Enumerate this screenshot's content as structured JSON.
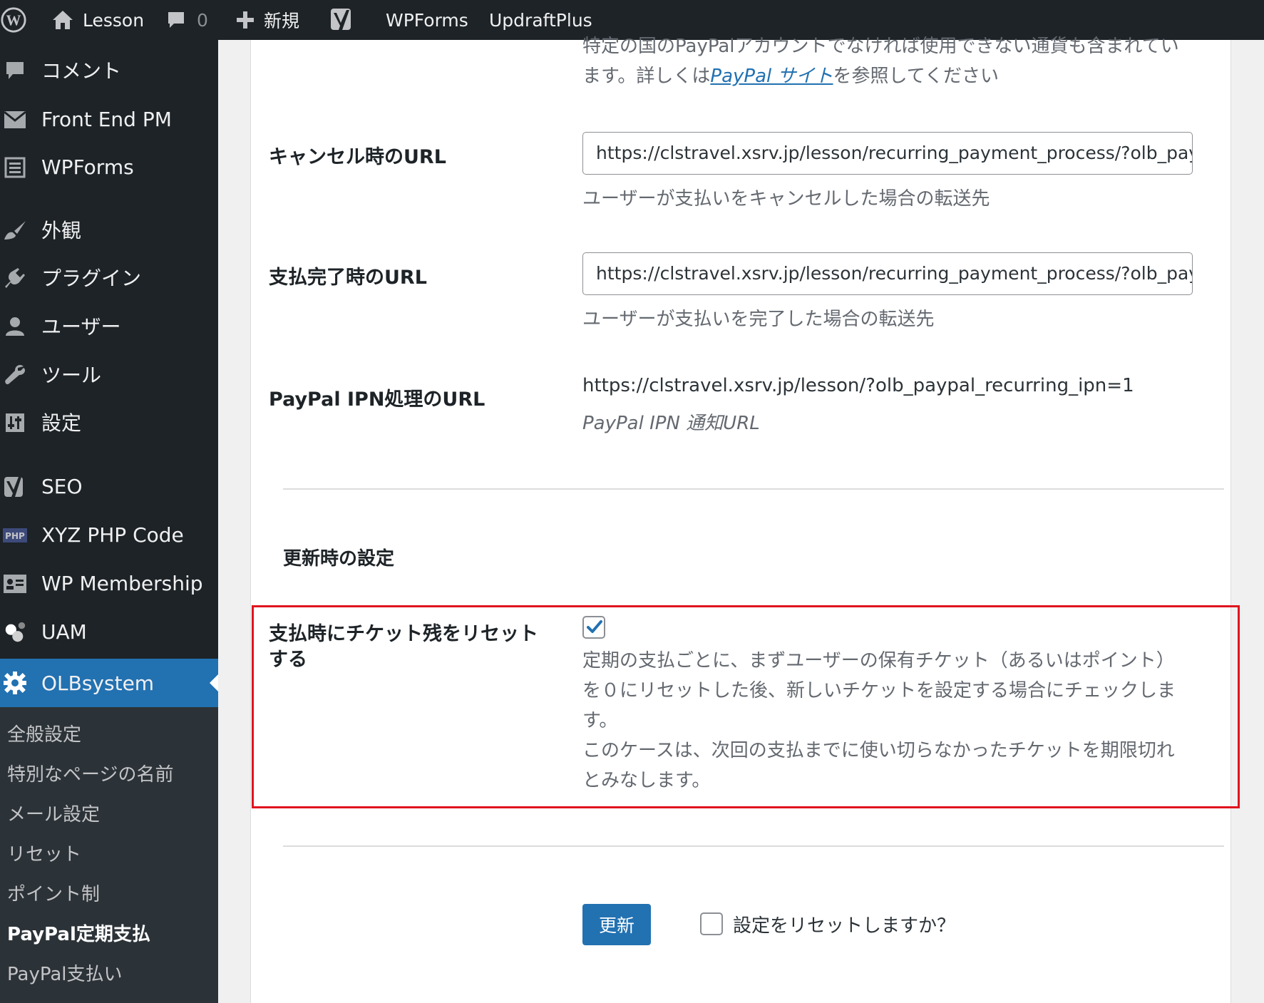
{
  "adminbar": {
    "site_name": "Lesson",
    "comments_count": "0",
    "new_label": "新規",
    "wpforms": "WPForms",
    "updraft": "UpdraftPlus"
  },
  "sidebar": {
    "items": [
      {
        "label": "コメント",
        "icon": "comment-icon"
      },
      {
        "label": "Front End PM",
        "icon": "mail-icon"
      },
      {
        "label": "WPForms",
        "icon": "forms-icon"
      },
      {
        "label": "外観",
        "icon": "paintbrush-icon"
      },
      {
        "label": "プラグイン",
        "icon": "plugin-icon"
      },
      {
        "label": "ユーザー",
        "icon": "user-icon"
      },
      {
        "label": "ツール",
        "icon": "wrench-icon"
      },
      {
        "label": "設定",
        "icon": "settings-sliders-icon"
      },
      {
        "label": "SEO",
        "icon": "yoast-icon"
      },
      {
        "label": "XYZ PHP Code",
        "icon": "php-icon"
      },
      {
        "label": "WP Membership",
        "icon": "id-card-icon"
      },
      {
        "label": "UAM",
        "icon": "uam-icon"
      },
      {
        "label": "OLBsystem",
        "icon": "gear-icon"
      }
    ],
    "submenu": [
      "全般設定",
      "特別なページの名前",
      "メール設定",
      "リセット",
      "ポイント制",
      "PayPal定期支払",
      "PayPal支払い"
    ]
  },
  "content": {
    "top_desc_line1": "特定の国のPayPalアカウントでなければ使用できない通貨も含まれてい",
    "top_desc_pre": "ます。詳しくは",
    "top_desc_link": "PayPal サイト",
    "top_desc_post": "を参照してください",
    "cancel_label": "キャンセル時のURL",
    "cancel_value": "https://clstravel.xsrv.jp/lesson/recurring_payment_process/?olb_paypal",
    "cancel_desc": "ユーザーが支払いをキャンセルした場合の転送先",
    "complete_label": "支払完了時のURL",
    "complete_value": "https://clstravel.xsrv.jp/lesson/recurring_payment_process/?olb_paypal",
    "complete_desc": "ユーザーが支払いを完了した場合の転送先",
    "ipn_label": "PayPal IPN処理のURL",
    "ipn_value": "https://clstravel.xsrv.jp/lesson/?olb_paypal_recurring_ipn=1",
    "ipn_desc": "PayPal IPN 通知URL",
    "section_title": "更新時の設定",
    "reset_label_1": "支払時にチケット残をリセット",
    "reset_label_2": "する",
    "reset_checked": true,
    "reset_desc": [
      "定期の支払ごとに、まずユーザーの保有チケット（あるいはポイント）",
      "を０にリセットした後、新しいチケットを設定する場合にチェックしま",
      "す。",
      "このケースは、次回の支払までに使い切らなかったチケットを期限切れ",
      "とみなします。"
    ],
    "submit_label": "更新",
    "reset_settings_label": "設定をリセットしますか？",
    "reset_settings_checked": false
  },
  "colors": {
    "adminbar_bg": "#1d2327",
    "menu_current": "#2271b1",
    "highlight_border": "#e0141e",
    "link": "#2271b1"
  }
}
